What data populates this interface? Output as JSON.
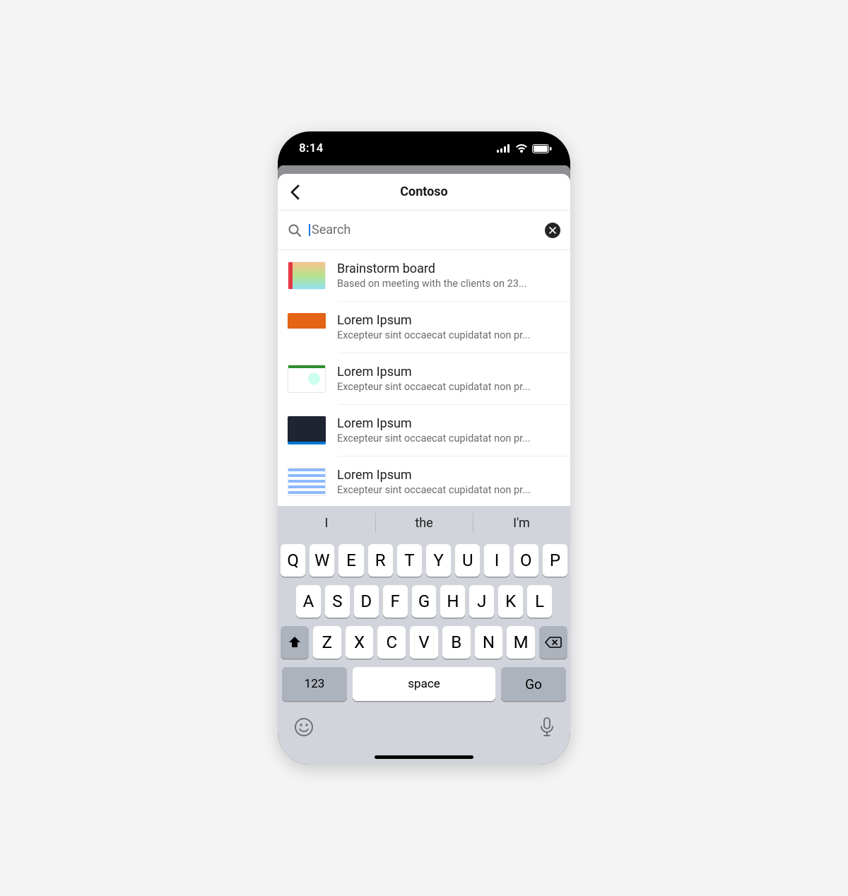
{
  "statusbar": {
    "time": "8:14"
  },
  "nav": {
    "title": "Contoso"
  },
  "search": {
    "placeholder": "Search"
  },
  "results": [
    {
      "title": "Brainstorm board",
      "subtitle": "Based on meeting with the clients on 23..."
    },
    {
      "title": "Lorem Ipsum",
      "subtitle": "Excepteur sint occaecat cupidatat non pr..."
    },
    {
      "title": "Lorem Ipsum",
      "subtitle": "Excepteur sint occaecat cupidatat non pr..."
    },
    {
      "title": "Lorem Ipsum",
      "subtitle": "Excepteur sint occaecat cupidatat non pr..."
    },
    {
      "title": "Lorem Ipsum",
      "subtitle": "Excepteur sint occaecat cupidatat non pr..."
    }
  ],
  "keyboard": {
    "suggestions": [
      "I",
      "the",
      "I'm"
    ],
    "row1": [
      "Q",
      "W",
      "E",
      "R",
      "T",
      "Y",
      "U",
      "I",
      "O",
      "P"
    ],
    "row2": [
      "A",
      "S",
      "D",
      "F",
      "G",
      "H",
      "J",
      "K",
      "L"
    ],
    "row3": [
      "Z",
      "X",
      "C",
      "V",
      "B",
      "N",
      "M"
    ],
    "num": "123",
    "space": "space",
    "go": "Go"
  }
}
